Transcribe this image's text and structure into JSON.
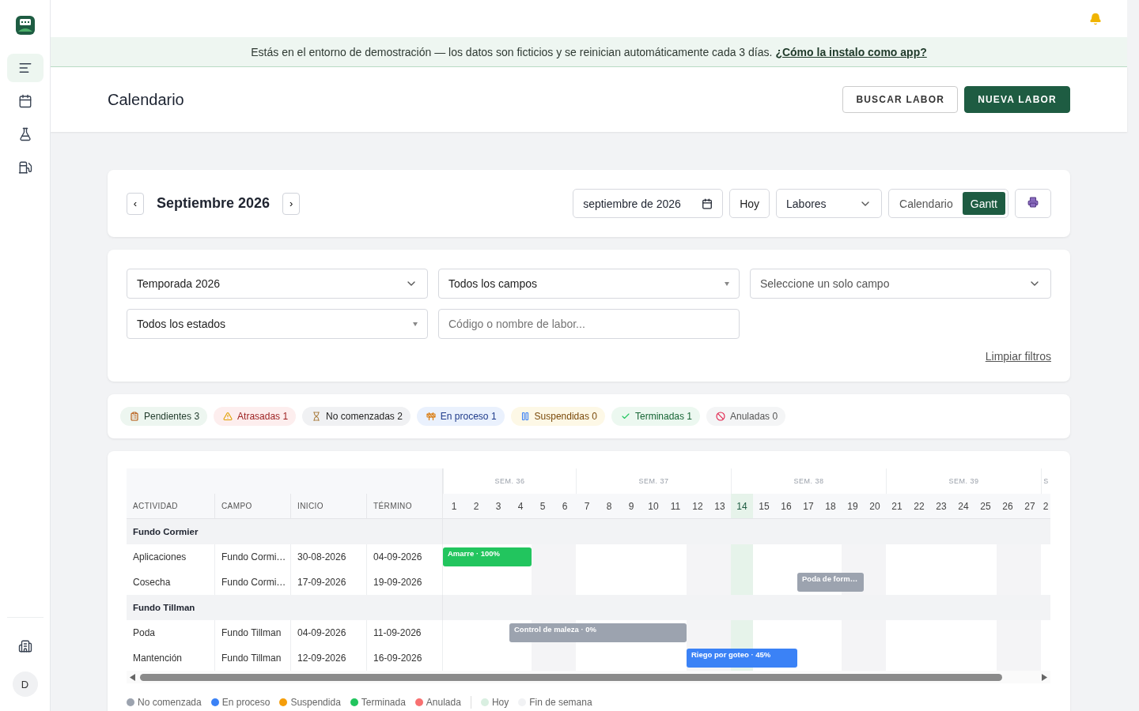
{
  "sidebar": {
    "nav": [
      {
        "selected": true
      },
      {
        "selected": false
      },
      {
        "selected": false
      },
      {
        "selected": false
      }
    ],
    "avatar": "D"
  },
  "banner": {
    "text": "Estás en el entorno de demostración — los datos son ficticios y se reinician automáticamente cada 3 días.",
    "link": "¿Cómo la instalo como app?"
  },
  "header": {
    "title": "Calendario",
    "buttons": [
      {
        "label": "BUSCAR LABOR",
        "kind": "outline"
      },
      {
        "label": "NUEVA LABOR",
        "kind": "primary"
      }
    ]
  },
  "toolbar": {
    "month": "Septiembre 2026",
    "prev": "‹",
    "next": "›",
    "date_value": "septiembre de 2026",
    "today": "Hoy",
    "mode": "Labores",
    "views": [
      {
        "label": "Calendario",
        "selected": false
      },
      {
        "label": "Gantt",
        "selected": true
      }
    ]
  },
  "filters": {
    "season": "Temporada 2026",
    "fields": "Todos los campos",
    "single_field_placeholder": "Seleccione un solo campo",
    "states": "Todos los estados",
    "search_placeholder": "Código o nombre de labor...",
    "clear": "Limpiar filtros"
  },
  "chips": [
    {
      "kind": "pending",
      "label": "Pendientes 3"
    },
    {
      "kind": "late",
      "label": "Atrasadas 1"
    },
    {
      "kind": "not_started",
      "label": "No comenzadas 2"
    },
    {
      "kind": "in_progress",
      "label": "En proceso 1"
    },
    {
      "kind": "suspended",
      "label": "Suspendidas 0"
    },
    {
      "kind": "done",
      "label": "Terminadas 1"
    },
    {
      "kind": "cancelled",
      "label": "Anuladas 0"
    }
  ],
  "gantt": {
    "columns": [
      "ACTIVIDAD",
      "CAMPO",
      "INICIO",
      "TÉRMINO"
    ],
    "weeks": [
      {
        "label": "SEM. 36"
      },
      {
        "label": "SEM. 37"
      },
      {
        "label": "SEM. 38"
      },
      {
        "label": "SEM. 39"
      },
      {
        "label": "S"
      }
    ],
    "days": [
      {
        "label": "1",
        "today": false
      },
      {
        "label": "2",
        "today": false
      },
      {
        "label": "3",
        "today": false
      },
      {
        "label": "4",
        "today": false
      },
      {
        "label": "5",
        "today": false
      },
      {
        "label": "6",
        "today": false
      },
      {
        "label": "7",
        "today": false
      },
      {
        "label": "8",
        "today": false
      },
      {
        "label": "9",
        "today": false
      },
      {
        "label": "10",
        "today": false
      },
      {
        "label": "11",
        "today": false
      },
      {
        "label": "12",
        "today": false
      },
      {
        "label": "13",
        "today": false
      },
      {
        "label": "14",
        "today": true
      },
      {
        "label": "15",
        "today": false
      },
      {
        "label": "16",
        "today": false
      },
      {
        "label": "17",
        "today": false
      },
      {
        "label": "18",
        "today": false
      },
      {
        "label": "19",
        "today": false
      },
      {
        "label": "20",
        "today": false
      },
      {
        "label": "21",
        "today": false
      },
      {
        "label": "22",
        "today": false
      },
      {
        "label": "23",
        "today": false
      },
      {
        "label": "24",
        "today": false
      },
      {
        "label": "25",
        "today": false
      },
      {
        "label": "26",
        "today": false
      },
      {
        "label": "27",
        "today": false
      },
      {
        "label": "2",
        "today": false
      }
    ],
    "groups": [
      {
        "name": "Fundo Cormier",
        "rows": [
          {
            "activity": "Aplicaciones",
            "field": "Fundo Cormi…",
            "start": "30-08-2026",
            "end": "04-09-2026",
            "bar": {
              "label": "Amarre · 100%",
              "kind": "done"
            }
          },
          {
            "activity": "Cosecha",
            "field": "Fundo Cormi…",
            "start": "17-09-2026",
            "end": "19-09-2026",
            "bar": {
              "label": "Poda de form…",
              "kind": "not_started"
            }
          }
        ]
      },
      {
        "name": "Fundo Tillman",
        "rows": [
          {
            "activity": "Poda",
            "field": "Fundo Tillman",
            "start": "04-09-2026",
            "end": "11-09-2026",
            "bar": {
              "label": "Control de maleza · 0%",
              "kind": "not_started"
            }
          },
          {
            "activity": "Mantención",
            "field": "Fundo Tillman",
            "start": "12-09-2026",
            "end": "16-09-2026",
            "bar": {
              "label": "Riego por goteo · 45%",
              "kind": "in_progress"
            }
          }
        ]
      }
    ],
    "legend": [
      {
        "label": "No comenzada",
        "color": "#9ca3af"
      },
      {
        "label": "En proceso",
        "color": "#3b82f6"
      },
      {
        "label": "Suspendida",
        "color": "#f59e0b"
      },
      {
        "label": "Terminada",
        "color": "#22c55e"
      },
      {
        "label": "Anulada",
        "color": "#f87171"
      },
      {
        "label": "Hoy",
        "color": "#d9efe1"
      },
      {
        "label": "Fin de semana",
        "color": "#f1f2f4"
      }
    ]
  }
}
